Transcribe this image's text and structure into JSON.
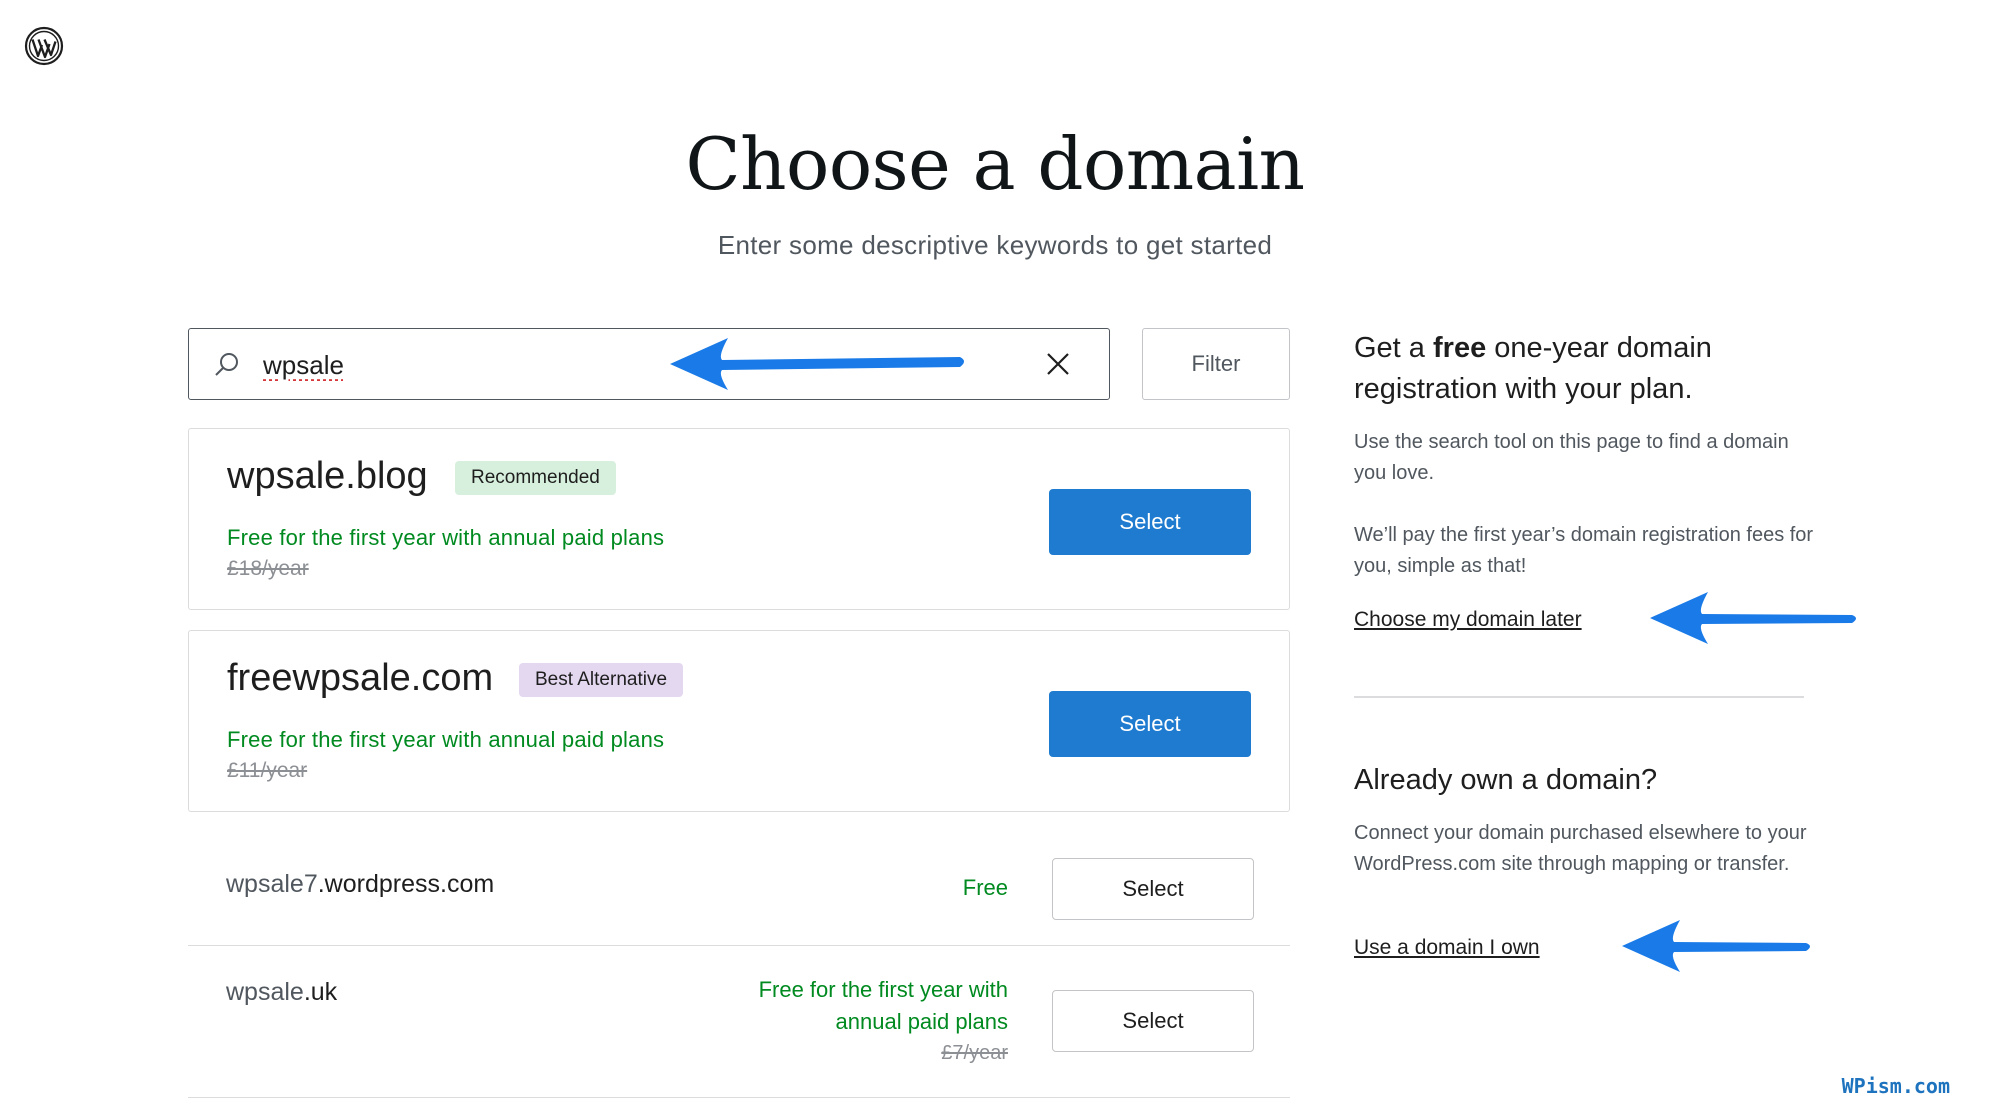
{
  "header": {
    "title": "Choose a domain",
    "subtitle": "Enter some descriptive keywords to get started"
  },
  "search": {
    "value": "wpsale"
  },
  "filter": {
    "label": "Filter"
  },
  "results": [
    {
      "domain": "wpsale.blog",
      "badge": "Recommended",
      "free_text": "Free for the first year with annual paid plans",
      "old_price": "£18/year",
      "select_label": "Select"
    },
    {
      "domain": "freewpsale.com",
      "badge": "Best Alternative",
      "free_text": "Free for the first year with annual paid plans",
      "old_price": "£11/year",
      "select_label": "Select"
    },
    {
      "domain_prefix": "wpsale7",
      "domain_suffix": ".wordpress.com",
      "price": "Free",
      "select_label": "Select"
    },
    {
      "domain_prefix": "wpsale",
      "domain_suffix": ".uk",
      "price_line1": "Free for the first year with",
      "price_line2": "annual paid plans",
      "old_price": "£7/year",
      "select_label": "Select"
    }
  ],
  "sidebar": {
    "heading_prefix": "Get a ",
    "heading_bold": "free",
    "heading_suffix": " one-year domain registration with your plan.",
    "para1": "Use the search tool on this page to find a domain you love.",
    "para2": "We’ll pay the first year’s domain registration fees for you, simple as that!",
    "link_later": "Choose my domain later",
    "own_heading": "Already own a domain?",
    "own_para": "Connect your domain purchased elsewhere to your WordPress.com site through mapping or transfer.",
    "link_own": "Use a domain I own"
  },
  "watermark": "WPism.com",
  "colors": {
    "primary": "#1e7bcf",
    "green": "#008a20",
    "arrow": "#1a7be8"
  },
  "icons": [
    "wordpress-logo-icon",
    "search-icon",
    "close-icon",
    "arrow-left-icon"
  ]
}
